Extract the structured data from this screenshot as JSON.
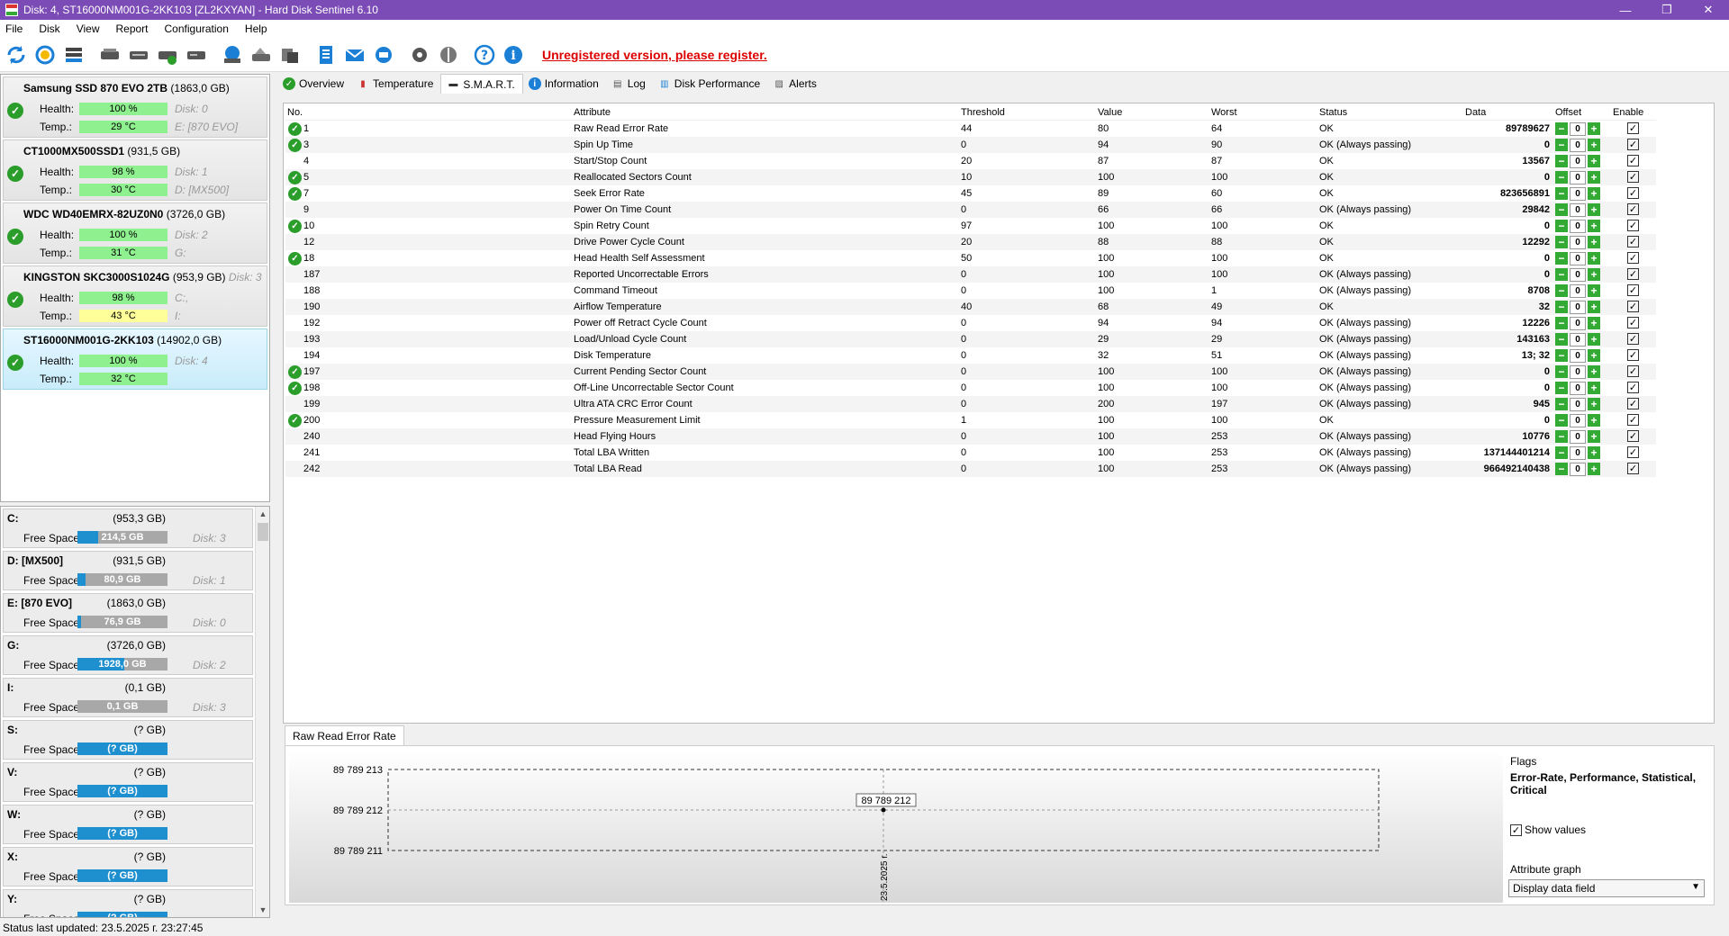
{
  "window": {
    "title": "Disk: 4, ST16000NM001G-2KK103 [ZL2KXYAN]  -  Hard Disk Sentinel 6.10",
    "minimize": "—",
    "maximize": "❐",
    "close": "✕"
  },
  "menu": [
    "File",
    "Disk",
    "View",
    "Report",
    "Configuration",
    "Help"
  ],
  "toolbar": {
    "register_text": "Unregistered version, please register."
  },
  "disks": [
    {
      "name": "Samsung SSD 870 EVO 2TB",
      "capacity": "(1863,0 GB)",
      "index_inline": "",
      "health_label": "Health:",
      "health": "100 %",
      "health_fraction": 1.0,
      "temp_label": "Temp.:",
      "temp": "29 °C",
      "side1": "Disk: 0",
      "side2": "E: [870 EVO]",
      "temp_color": "#8ef08e"
    },
    {
      "name": "CT1000MX500SSD1",
      "capacity": "(931,5 GB)",
      "index_inline": "",
      "health_label": "Health:",
      "health": "98 %",
      "health_fraction": 0.98,
      "temp_label": "Temp.:",
      "temp": "30 °C",
      "side1": "Disk: 1",
      "side2": "D: [MX500]",
      "temp_color": "#8ef08e"
    },
    {
      "name": "WDC WD40EMRX-82UZ0N0",
      "capacity": "(3726,0 GB)",
      "index_inline": "",
      "health_label": "Health:",
      "health": "100 %",
      "health_fraction": 1.0,
      "temp_label": "Temp.:",
      "temp": "31 °C",
      "side1": "Disk: 2",
      "side2": "G:",
      "temp_color": "#8ef08e"
    },
    {
      "name": "KINGSTON SKC3000S1024G",
      "capacity": "(953,9 GB)",
      "index_inline": "Disk: 3",
      "health_label": "Health:",
      "health": "98 %",
      "health_fraction": 0.98,
      "temp_label": "Temp.:",
      "temp": "43 °C",
      "side1": "C:,",
      "side2": "I:",
      "temp_color": "#ffff99"
    },
    {
      "name": "ST16000NM001G-2KK103",
      "capacity": "(14902,0 GB)",
      "index_inline": "",
      "health_label": "Health:",
      "health": "100 %",
      "health_fraction": 1.0,
      "temp_label": "Temp.:",
      "temp": "32 °C",
      "side1": "Disk: 4",
      "side2": "",
      "temp_color": "#8ef08e"
    }
  ],
  "volumes": [
    {
      "name": "C:",
      "capacity": "(953,3 GB)",
      "free_label": "Free Space",
      "free": "214,5 GB",
      "free_fraction": 0.23,
      "disk": "Disk: 3"
    },
    {
      "name": "D: [MX500]",
      "capacity": "(931,5 GB)",
      "free_label": "Free Space",
      "free": "80,9 GB",
      "free_fraction": 0.09,
      "disk": "Disk: 1"
    },
    {
      "name": "E: [870 EVO]",
      "capacity": "(1863,0 GB)",
      "free_label": "Free Space",
      "free": "76,9 GB",
      "free_fraction": 0.04,
      "disk": "Disk: 0"
    },
    {
      "name": "G:",
      "capacity": "(3726,0 GB)",
      "free_label": "Free Space",
      "free": "1928,0 GB",
      "free_fraction": 0.52,
      "disk": "Disk: 2"
    },
    {
      "name": "I:",
      "capacity": "(0,1 GB)",
      "free_label": "Free Space",
      "free": "0,1 GB",
      "free_fraction": 0.0,
      "disk": "Disk: 3"
    },
    {
      "name": "S:",
      "capacity": "(? GB)",
      "free_label": "Free Space",
      "free": "(? GB)",
      "free_fraction": 1.0,
      "disk": ""
    },
    {
      "name": "V:",
      "capacity": "(? GB)",
      "free_label": "Free Space",
      "free": "(? GB)",
      "free_fraction": 1.0,
      "disk": ""
    },
    {
      "name": "W:",
      "capacity": "(? GB)",
      "free_label": "Free Space",
      "free": "(? GB)",
      "free_fraction": 1.0,
      "disk": ""
    },
    {
      "name": "X:",
      "capacity": "(? GB)",
      "free_label": "Free Space",
      "free": "(? GB)",
      "free_fraction": 1.0,
      "disk": ""
    },
    {
      "name": "Y:",
      "capacity": "(? GB)",
      "free_label": "Free Space",
      "free": "(? GB)",
      "free_fraction": 1.0,
      "disk": ""
    }
  ],
  "tabs": [
    {
      "label": "Overview",
      "icon": "check-icon"
    },
    {
      "label": "Temperature",
      "icon": "thermometer-icon"
    },
    {
      "label": "S.M.A.R.T.",
      "icon": "disk-icon",
      "active": true
    },
    {
      "label": "Information",
      "icon": "info-icon"
    },
    {
      "label": "Log",
      "icon": "log-icon"
    },
    {
      "label": "Disk Performance",
      "icon": "performance-icon"
    },
    {
      "label": "Alerts",
      "icon": "alert-icon"
    }
  ],
  "smart": {
    "headers": [
      "No.",
      "Attribute",
      "Threshold",
      "Value",
      "Worst",
      "Status",
      "Data",
      "Offset",
      "Enable"
    ],
    "rows": [
      {
        "no": "1",
        "check": true,
        "attr": "Raw Read Error Rate",
        "thr": "44",
        "val": "80",
        "worst": "64",
        "status": "OK",
        "data": "89789627",
        "offset": "0"
      },
      {
        "no": "3",
        "check": true,
        "attr": "Spin Up Time",
        "thr": "0",
        "val": "94",
        "worst": "90",
        "status": "OK (Always passing)",
        "data": "0",
        "offset": "0"
      },
      {
        "no": "4",
        "check": false,
        "attr": "Start/Stop Count",
        "thr": "20",
        "val": "87",
        "worst": "87",
        "status": "OK",
        "data": "13567",
        "offset": "0"
      },
      {
        "no": "5",
        "check": true,
        "attr": "Reallocated Sectors Count",
        "thr": "10",
        "val": "100",
        "worst": "100",
        "status": "OK",
        "data": "0",
        "offset": "0"
      },
      {
        "no": "7",
        "check": true,
        "attr": "Seek Error Rate",
        "thr": "45",
        "val": "89",
        "worst": "60",
        "status": "OK",
        "data": "823656891",
        "offset": "0"
      },
      {
        "no": "9",
        "check": false,
        "attr": "Power On Time Count",
        "thr": "0",
        "val": "66",
        "worst": "66",
        "status": "OK (Always passing)",
        "data": "29842",
        "offset": "0"
      },
      {
        "no": "10",
        "check": true,
        "attr": "Spin Retry Count",
        "thr": "97",
        "val": "100",
        "worst": "100",
        "status": "OK",
        "data": "0",
        "offset": "0"
      },
      {
        "no": "12",
        "check": false,
        "attr": "Drive Power Cycle Count",
        "thr": "20",
        "val": "88",
        "worst": "88",
        "status": "OK",
        "data": "12292",
        "offset": "0"
      },
      {
        "no": "18",
        "check": true,
        "attr": "Head Health Self Assessment",
        "thr": "50",
        "val": "100",
        "worst": "100",
        "status": "OK",
        "data": "0",
        "offset": "0"
      },
      {
        "no": "187",
        "check": false,
        "attr": "Reported Uncorrectable Errors",
        "thr": "0",
        "val": "100",
        "worst": "100",
        "status": "OK (Always passing)",
        "data": "0",
        "offset": "0"
      },
      {
        "no": "188",
        "check": false,
        "attr": "Command Timeout",
        "thr": "0",
        "val": "100",
        "worst": "1",
        "status": "OK (Always passing)",
        "data": "8708",
        "offset": "0"
      },
      {
        "no": "190",
        "check": false,
        "attr": "Airflow Temperature",
        "thr": "40",
        "val": "68",
        "worst": "49",
        "status": "OK",
        "data": "32",
        "offset": "0"
      },
      {
        "no": "192",
        "check": false,
        "attr": "Power off Retract Cycle Count",
        "thr": "0",
        "val": "94",
        "worst": "94",
        "status": "OK (Always passing)",
        "data": "12226",
        "offset": "0"
      },
      {
        "no": "193",
        "check": false,
        "attr": "Load/Unload Cycle Count",
        "thr": "0",
        "val": "29",
        "worst": "29",
        "status": "OK (Always passing)",
        "data": "143163",
        "offset": "0"
      },
      {
        "no": "194",
        "check": false,
        "attr": "Disk Temperature",
        "thr": "0",
        "val": "32",
        "worst": "51",
        "status": "OK (Always passing)",
        "data": "13; 32",
        "offset": "0"
      },
      {
        "no": "197",
        "check": true,
        "attr": "Current Pending Sector Count",
        "thr": "0",
        "val": "100",
        "worst": "100",
        "status": "OK (Always passing)",
        "data": "0",
        "offset": "0"
      },
      {
        "no": "198",
        "check": true,
        "attr": "Off-Line Uncorrectable Sector Count",
        "thr": "0",
        "val": "100",
        "worst": "100",
        "status": "OK (Always passing)",
        "data": "0",
        "offset": "0"
      },
      {
        "no": "199",
        "check": false,
        "attr": "Ultra ATA CRC Error Count",
        "thr": "0",
        "val": "200",
        "worst": "197",
        "status": "OK (Always passing)",
        "data": "945",
        "offset": "0"
      },
      {
        "no": "200",
        "check": true,
        "attr": "Pressure Measurement Limit",
        "thr": "1",
        "val": "100",
        "worst": "100",
        "status": "OK",
        "data": "0",
        "offset": "0"
      },
      {
        "no": "240",
        "check": false,
        "attr": "Head Flying Hours",
        "thr": "0",
        "val": "100",
        "worst": "253",
        "status": "OK (Always passing)",
        "data": "10776",
        "offset": "0"
      },
      {
        "no": "241",
        "check": false,
        "attr": "Total LBA Written",
        "thr": "0",
        "val": "100",
        "worst": "253",
        "status": "OK (Always passing)",
        "data": "137144401214",
        "offset": "0"
      },
      {
        "no": "242",
        "check": false,
        "attr": "Total LBA Read",
        "thr": "0",
        "val": "100",
        "worst": "253",
        "status": "OK (Always passing)",
        "data": "966492140438",
        "offset": "0"
      }
    ]
  },
  "graph": {
    "tab_label": "Raw Read Error Rate",
    "y_labels": [
      "89 789 213",
      "89 789 212",
      "89 789 211"
    ],
    "point_label": "89 789 212",
    "x_label": "23.5.2025 г.",
    "flags_title": "Flags",
    "flags_value": "Error-Rate, Performance, Statistical, Critical",
    "show_values_label": "Show values",
    "attr_graph_label": "Attribute graph",
    "attr_graph_value": "Display data field"
  },
  "status": {
    "text": "Status last updated: 23.5.2025 г. 23:27:45"
  }
}
